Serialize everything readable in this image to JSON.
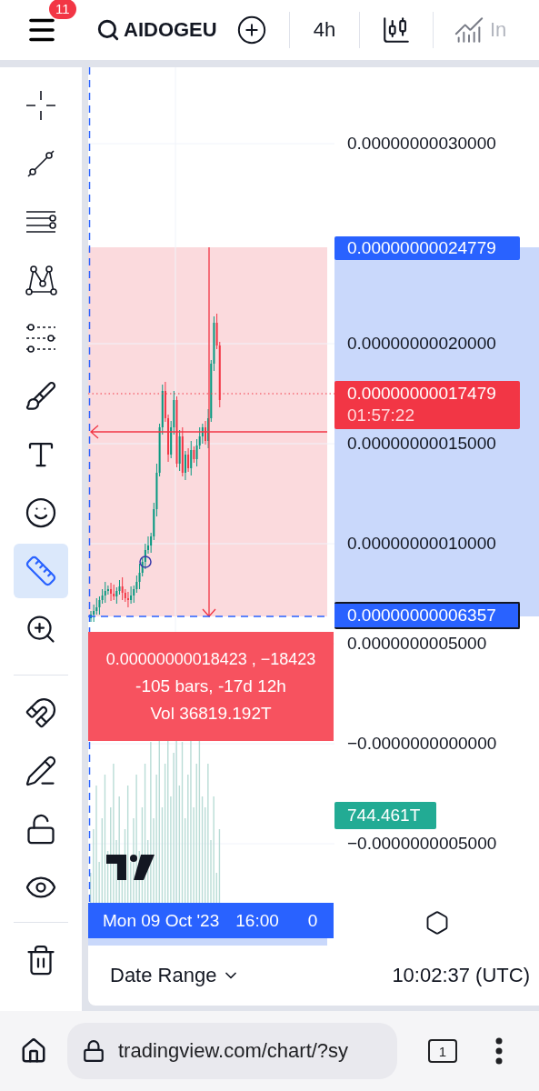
{
  "toolbar": {
    "menu_badge": "11",
    "symbol": "AIDOGEU",
    "interval": "4h",
    "indicators_label": "In"
  },
  "tool_groups": [
    [
      {
        "kind": "crosshair",
        "selected": false
      },
      {
        "kind": "trend-line",
        "selected": false
      },
      {
        "kind": "horizontal-lines",
        "selected": false
      },
      {
        "kind": "pattern",
        "selected": false
      },
      {
        "kind": "fib",
        "selected": false
      },
      {
        "kind": "brush",
        "selected": false
      },
      {
        "kind": "text",
        "selected": false
      },
      {
        "kind": "emoji",
        "selected": false
      },
      {
        "kind": "ruler",
        "selected": true
      },
      {
        "kind": "zoom",
        "selected": false
      }
    ],
    [
      {
        "kind": "magnet",
        "selected": false
      },
      {
        "kind": "pencil-lock",
        "selected": false
      },
      {
        "kind": "lock",
        "selected": false
      },
      {
        "kind": "eye",
        "selected": false
      }
    ],
    [
      {
        "kind": "trash",
        "selected": false
      }
    ]
  ],
  "chart": {
    "price_axis": [
      "0.00000000030000",
      "0.00000000020000",
      "0.00000000015000",
      "0.00000000010000",
      "0.0000000005000",
      "−0.0000000000000",
      "−0.0000000005000"
    ],
    "measure": {
      "high": "0.00000000024779",
      "low": "0.00000000006357",
      "lines": [
        "0.00000000018423 , −18423",
        "-105 bars, -17d 12h",
        "Vol 36819.192T"
      ]
    },
    "last_price": {
      "value": "0.00000000017479",
      "countdown": "01:57:22"
    },
    "volume_label": "744.461T",
    "time_label": {
      "date": "Mon 09 Oct '23",
      "time": "16:00",
      "cut": "0"
    }
  },
  "bottom_bar": {
    "date_range": "Date Range",
    "clock": "10:02:37 (UTC)"
  },
  "browser": {
    "url": "tradingview.com/chart/?sy",
    "tab_count": "1"
  }
}
